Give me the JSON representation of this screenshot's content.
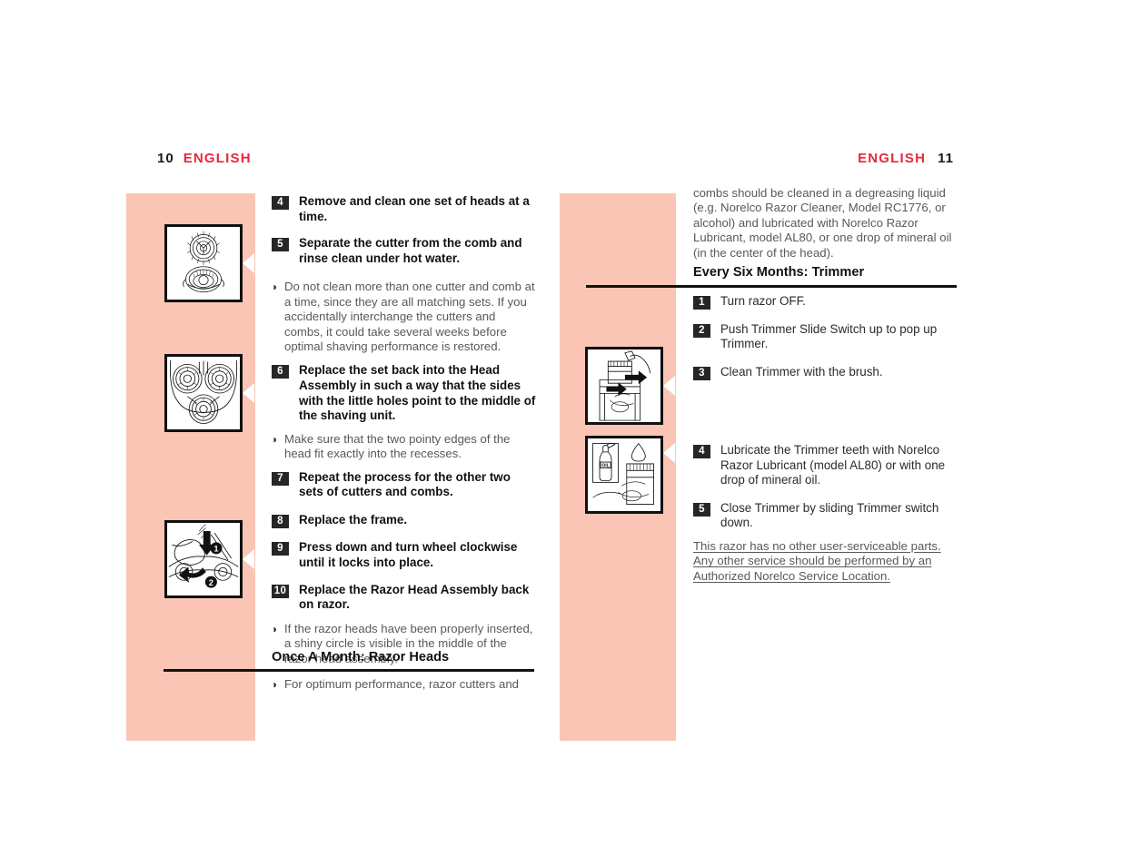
{
  "page": {
    "left_header": {
      "folio": "10",
      "label": "ENGLISH"
    },
    "right_header": {
      "label": "ENGLISH",
      "folio": "11"
    },
    "accent_red": "#e8283c",
    "panel_pink": "#fac5b4",
    "badge_dark": "#262626",
    "bullet_glyph": "◗"
  },
  "left_column": {
    "steps_top": [
      {
        "num": "4",
        "text": "Remove and clean one set of heads at a time."
      },
      {
        "num": "5",
        "text": "Separate the cutter from the comb and rinse clean under hot water."
      }
    ],
    "note_1": "Do not clean more than one cutter and comb at a time, since they are all matching sets. If you accidentally interchange the cutters and combs, it could take several weeks before optimal shaving performance is restored.",
    "step_6": {
      "num": "6",
      "text": "Replace the set back into the Head Assembly in such a way that the sides with the little holes point to the middle of the shaving unit."
    },
    "note_2": "Make sure that the two pointy edges of the head fit exactly into the recesses.",
    "steps_mid": [
      {
        "num": "7",
        "text": "Repeat the process for the other two sets of cutters and combs."
      },
      {
        "num": "8",
        "text": "Replace the frame."
      },
      {
        "num": "9",
        "text": "Press down and turn wheel clockwise until it locks into place."
      },
      {
        "num": "10",
        "text": "Replace the Razor Head Assembly back on razor."
      }
    ],
    "note_3": "If the razor heads have been properly inserted, a shiny circle is visible in the middle of the razor head assembly.",
    "section_heading": "Once A Month: Razor Heads",
    "note_4": "For optimum performance, razor cutters and"
  },
  "right_column": {
    "continuation": "combs should be cleaned in a degreasing liquid (e.g. Norelco Razor Cleaner, Model RC1776, or alcohol) and lubricated with Norelco Razor Lubricant, model AL80, or one drop of mineral oil (in the center of the head).",
    "section_heading": "Every Six Months: Trimmer",
    "steps_top": [
      {
        "num": "1",
        "text": "Turn razor OFF."
      },
      {
        "num": "2",
        "text": "Push Trimmer Slide Switch up to pop up Trimmer."
      },
      {
        "num": "3",
        "text": "Clean Trimmer with the brush."
      }
    ],
    "steps_bottom": [
      {
        "num": "4",
        "text": "Lubricate the Trimmer teeth with Norelco Razor Lubricant (model AL80) or with one drop of mineral oil."
      },
      {
        "num": "5",
        "text": "Close Trimmer by sliding Trimmer switch down."
      }
    ],
    "disclaimer": "This razor has no other user-serviceable parts. Any other service should be performed by an Authorized Norelco Service Location."
  },
  "figures": {
    "fig_cutter_comb": "cutter-and-comb-illustration",
    "fig_head_assembly": "three-head-assembly-illustration",
    "fig_press_turn": "press-down-turn-wheel-illustration",
    "fig_trimmer_brush": "clean-trimmer-with-brush-illustration",
    "fig_trimmer_oil": "lubricate-trimmer-oil-illustration",
    "oil_bottle_label": "OIL",
    "callout_1": "1",
    "callout_2": "2"
  }
}
